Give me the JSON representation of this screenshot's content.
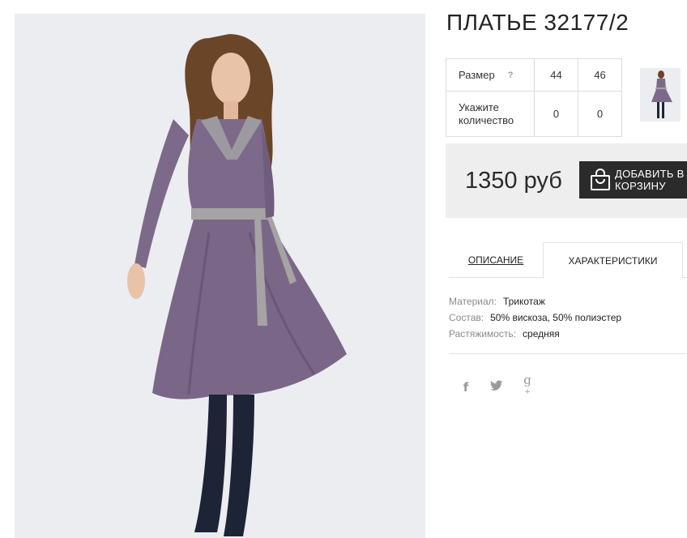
{
  "product": {
    "title": "ПЛАТЬЕ 32177/2"
  },
  "sizes": {
    "size_label": "Размер",
    "help_icon": "?",
    "qty_label": "Укажите количество",
    "columns": [
      {
        "size": "44",
        "qty": "0"
      },
      {
        "size": "46",
        "qty": "0"
      }
    ]
  },
  "purchase": {
    "price": "1350 руб",
    "add_label": "ДОБАВИТЬ В КОРЗИНУ",
    "add_icon": "shopping-bag-icon"
  },
  "tabs": {
    "description": "ОПИСАНИЕ",
    "characteristics": "ХАРАКТЕРИСТИКИ",
    "active": "characteristics"
  },
  "attributes": [
    {
      "key": "Материал:",
      "value": "Трикотаж"
    },
    {
      "key": "Состав:",
      "value": "50% вискоза, 50% полиэстер"
    },
    {
      "key": "Растяжимость:",
      "value": "средняя"
    }
  ],
  "social": {
    "facebook": "f",
    "twitter": "t",
    "google_plus": "g",
    "google_plus_sup": "+"
  },
  "colors": {
    "dress": "#7d6a8a",
    "belt": "#a5a3a3",
    "boots": "#1d2436",
    "hair": "#6b4528",
    "background": "#ecedf0",
    "button": "#2b2b2b",
    "price_box": "#eeeeef"
  }
}
